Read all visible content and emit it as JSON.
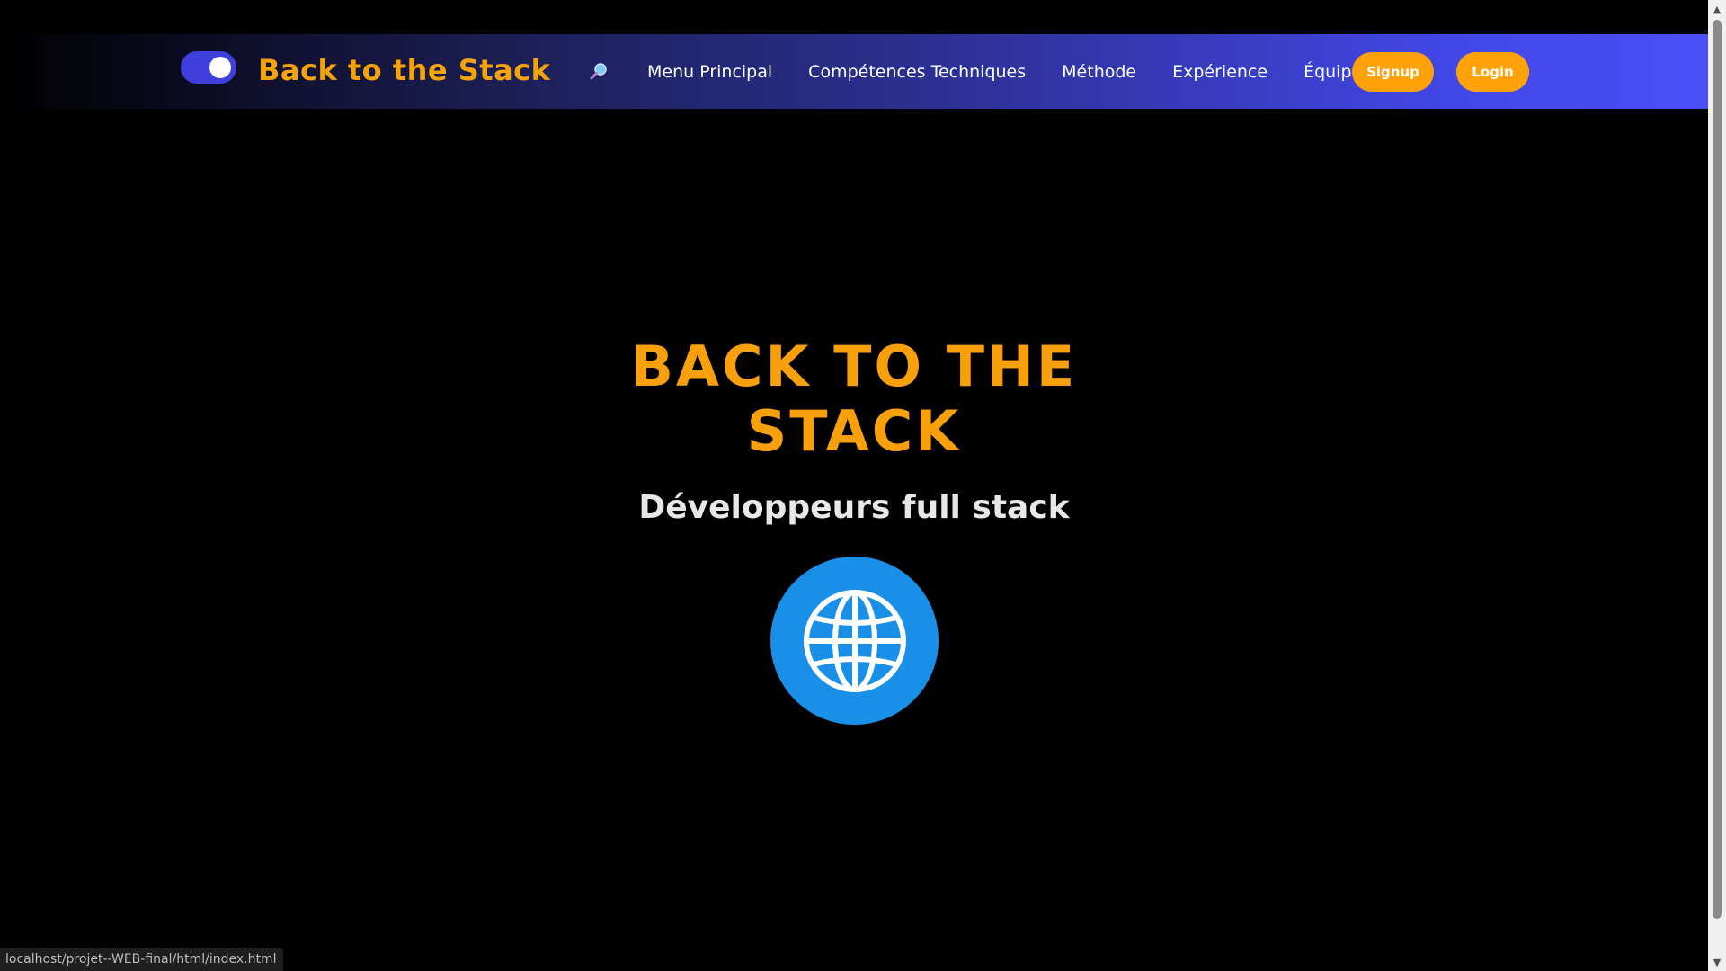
{
  "navbar": {
    "brand": "Back to the Stack",
    "toggle_icon": "theme-toggle-icon",
    "search_icon": "search-icon",
    "links": [
      "Menu Principal",
      "Compétences Techniques",
      "Méthode",
      "Expérience",
      "Équipe"
    ],
    "signup_label": "Signup",
    "login_label": "Login"
  },
  "hero": {
    "title": "Back to the Stack",
    "subtitle": "Développeurs full stack",
    "icon": "globe-icon"
  },
  "status_bar": {
    "url": "localhost/projet--WEB-final/html/index.html"
  },
  "colors": {
    "accent": "#f7a00b",
    "nav_end": "#4a4ff7",
    "globe": "#1a8fe8",
    "toggle": "#3f3fdc"
  }
}
